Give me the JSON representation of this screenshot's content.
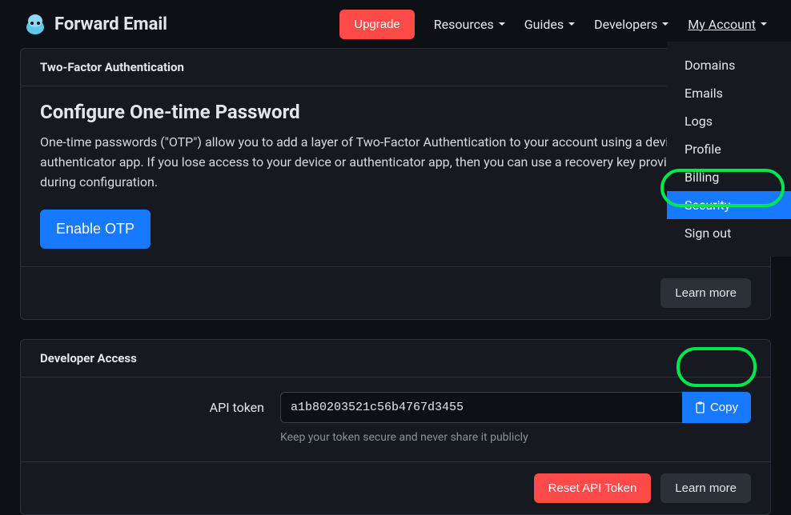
{
  "brand": {
    "text": "Forward Email"
  },
  "nav": {
    "upgrade": "Upgrade",
    "resources": "Resources",
    "guides": "Guides",
    "developers": "Developers",
    "my_account": "My Account"
  },
  "dropdown": {
    "items": [
      "Domains",
      "Emails",
      "Logs",
      "Profile",
      "Billing",
      "Security",
      "Sign out"
    ],
    "active_index": 5
  },
  "twofa_card": {
    "header": "Two-Factor Authentication",
    "title": "Configure One-time Password",
    "desc": "One-time passwords (\"OTP\") allow you to add a layer of Two-Factor Authentication to your account using a device or authenticator app. If you lose access to your device or authenticator app, then you can use a recovery key provided to you during configuration.",
    "enable_btn": "Enable OTP",
    "learn_more": "Learn more"
  },
  "dev_card": {
    "header": "Developer Access",
    "label": "API token",
    "token": "a1b80203521c56b4767d3455",
    "copy": "Copy",
    "help": "Keep your token secure and never share it publicly",
    "reset": "Reset API Token",
    "learn_more": "Learn more"
  }
}
